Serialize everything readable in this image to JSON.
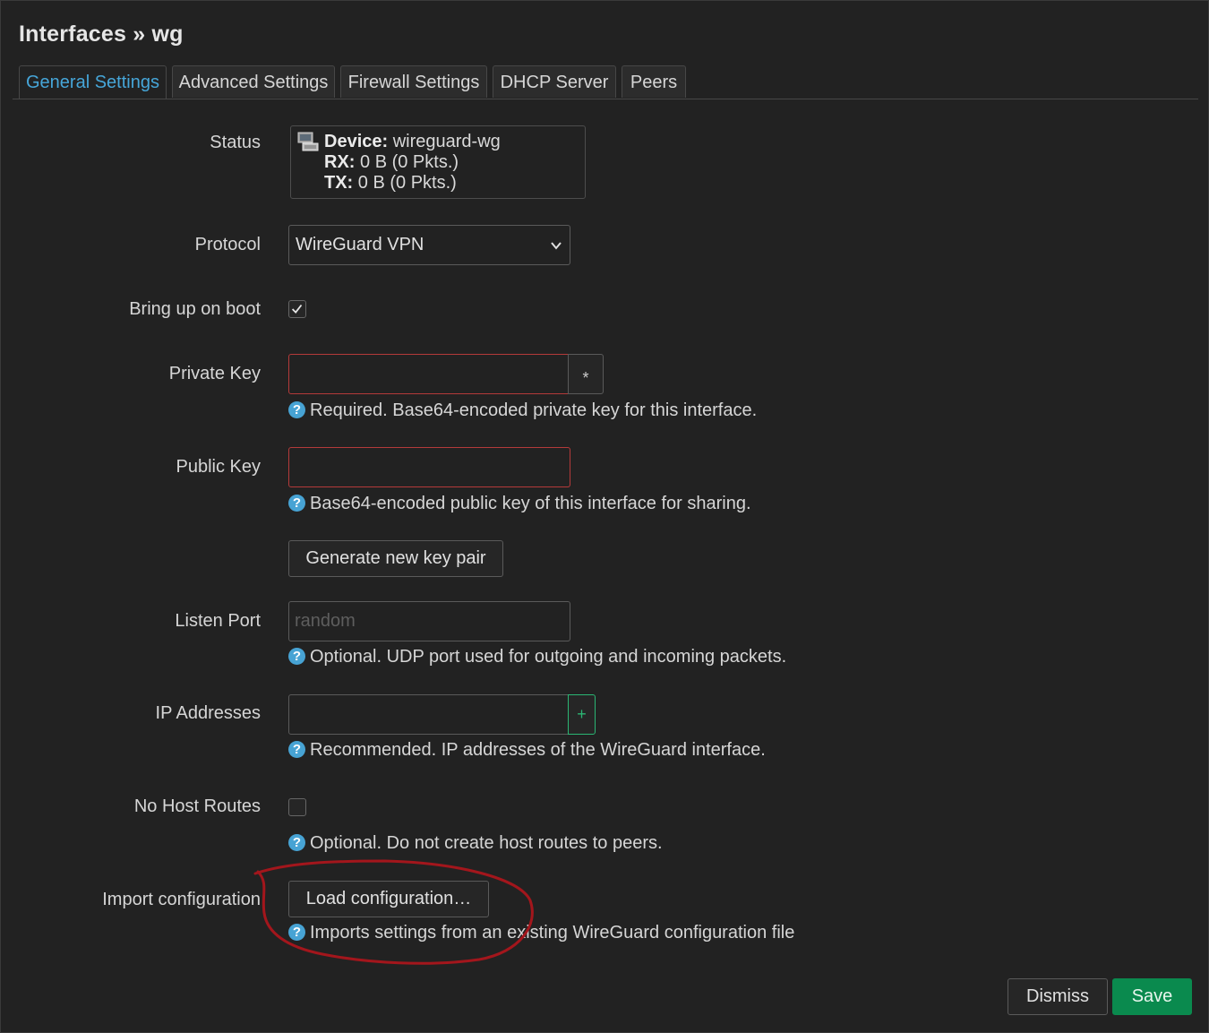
{
  "header": {
    "title": "Interfaces » wg"
  },
  "tabs": [
    {
      "label": "General Settings",
      "active": true
    },
    {
      "label": "Advanced Settings",
      "active": false
    },
    {
      "label": "Firewall Settings",
      "active": false
    },
    {
      "label": "DHCP Server",
      "active": false
    },
    {
      "label": "Peers",
      "active": false
    }
  ],
  "status": {
    "label": "Status",
    "device_key": "Device:",
    "device_value": "wireguard-wg",
    "rx_key": "RX:",
    "rx_value": "0 B (0 Pkts.)",
    "tx_key": "TX:",
    "tx_value": "0 B (0 Pkts.)"
  },
  "protocol": {
    "label": "Protocol",
    "value": "WireGuard VPN"
  },
  "bring_up_on_boot": {
    "label": "Bring up on boot",
    "checked": true
  },
  "private_key": {
    "label": "Private Key",
    "value": "",
    "toggle_symbol": "*",
    "help": "Required. Base64-encoded private key for this interface."
  },
  "public_key": {
    "label": "Public Key",
    "value": "",
    "help": "Base64-encoded public key of this interface for sharing."
  },
  "generate_button": {
    "label": "Generate new key pair"
  },
  "listen_port": {
    "label": "Listen Port",
    "placeholder": "random",
    "help": "Optional. UDP port used for outgoing and incoming packets."
  },
  "ip_addresses": {
    "label": "IP Addresses",
    "value": "",
    "add_symbol": "+",
    "help": "Recommended. IP addresses of the WireGuard interface."
  },
  "no_host_routes": {
    "label": "No Host Routes",
    "checked": false,
    "help": "Optional. Do not create host routes to peers."
  },
  "import_configuration": {
    "label": "Import configuration",
    "button_label": "Load configuration…",
    "help": "Imports settings from an existing WireGuard configuration file"
  },
  "footer": {
    "dismiss_label": "Dismiss",
    "save_label": "Save"
  },
  "colors": {
    "background": "#222222",
    "accent": "#46a6d9",
    "error_border": "#b43a3a",
    "save_green": "#0a8a4e",
    "annotation": "#a3161c",
    "plus_green": "#2bb673"
  },
  "icons": {
    "status": "network-device-icon",
    "select": "chevron-down-icon",
    "help": "help-icon"
  },
  "help_symbol": "?"
}
